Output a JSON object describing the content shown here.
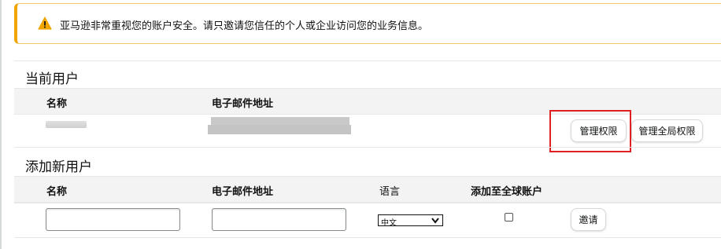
{
  "alert": {
    "icon": "warning-icon",
    "message": "亚马逊非常重视您的账户安全。请只邀请您信任的个人或企业访问您的业务信息。",
    "accent_color": "#f0a500"
  },
  "current_users": {
    "title": "当前用户",
    "columns": {
      "name": "名称",
      "email": "电子邮件地址"
    },
    "rows": [
      {
        "name": "",
        "email": "",
        "manage_permissions": "管理权限",
        "manage_global_permissions": "管理全局权限"
      }
    ]
  },
  "add_user": {
    "title": "添加新用户",
    "columns": {
      "name": "名称",
      "email": "电子邮件地址",
      "language": "语言",
      "add_global": "添加至全球账户"
    },
    "language_value": "中文",
    "add_global_checked": false,
    "invite_label": "邀请"
  },
  "highlight_color": "#e02020"
}
